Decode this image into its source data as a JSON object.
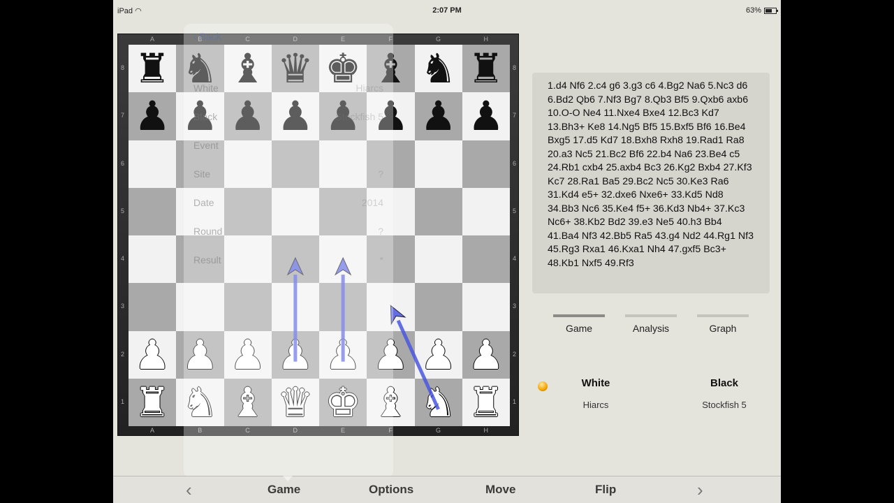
{
  "status_bar": {
    "device": "iPad",
    "wifi_icon": "wifi-icon",
    "time": "2:07 PM",
    "battery": "63%",
    "battery_fraction": 0.63
  },
  "board": {
    "files": [
      "A",
      "B",
      "C",
      "D",
      "E",
      "F",
      "G",
      "H"
    ],
    "ranks": [
      "8",
      "7",
      "6",
      "5",
      "4",
      "3",
      "2",
      "1"
    ],
    "position": [
      [
        "r",
        "n",
        "b",
        "q",
        "k",
        "b",
        "n",
        "r"
      ],
      [
        "p",
        "p",
        "p",
        "p",
        "p",
        "p",
        "p",
        "p"
      ],
      [
        "",
        "",
        "",
        "",
        "",
        "",
        "",
        ""
      ],
      [
        "",
        "",
        "",
        "",
        "",
        "",
        "",
        ""
      ],
      [
        "",
        "",
        "",
        "",
        "",
        "",
        "",
        ""
      ],
      [
        "",
        "",
        "",
        "",
        "",
        "",
        "",
        ""
      ],
      [
        "P",
        "P",
        "P",
        "P",
        "P",
        "P",
        "P",
        "P"
      ],
      [
        "R",
        "N",
        "B",
        "Q",
        "K",
        "B",
        "N",
        "R"
      ]
    ],
    "arrows": [
      {
        "from": "d2",
        "to": "d4"
      },
      {
        "from": "e2",
        "to": "e4"
      },
      {
        "from": "g1",
        "to": "f3"
      }
    ],
    "arrow_color": "#4a57e0"
  },
  "game_info_popup": {
    "back_label": "Back",
    "right_header": "",
    "rows": [
      {
        "label": "White",
        "value": "Hiarcs"
      },
      {
        "label": "Black",
        "value": "Stockfish 5"
      },
      {
        "label": "Event",
        "value": ""
      },
      {
        "label": "Site",
        "value": "?"
      },
      {
        "label": "Date",
        "value": "2014"
      },
      {
        "label": "Round",
        "value": "?"
      },
      {
        "label": "Result",
        "value": "*"
      }
    ]
  },
  "moves": {
    "text": "1.d4 Nf6 2.c4 g6 3.g3 c6 4.Bg2 Na6 5.Nc3 d6 6.Bd2 Qb6 7.Nf3 Bg7 8.Qb3 Bf5 9.Qxb6 axb6 10.O-O Ne4 11.Nxe4 Bxe4 12.Bc3 Kd7 13.Bh3+ Ke8 14.Ng5 Bf5 15.Bxf5 Bf6 16.Be4 Bxg5 17.d5 Kd7 18.Bxh8 Rxh8 19.Rad1 Ra8 20.a3 Nc5 21.Bc2 Bf6 22.b4 Na6 23.Be4 c5 24.Rb1 cxb4 25.axb4 Bc3 26.Kg2 Bxb4 27.Kf3 Kc7 28.Ra1 Ba5 29.Bc2 Nc5 30.Ke3 Ra6 31.Kd4 e5+ 32.dxe6 Nxe6+ 33.Kd5 Nd8 34.Bb3 Nc6 35.Ke4 f5+ 36.Kd3 Nb4+ 37.Kc3 Nc6+ 38.Kb2 Bd2 39.e3 Ne5 40.h3 Bb4 41.Ba4 Nf3 42.Bb5 Ra5 43.g4 Nd2 44.Rg1 Nf3 45.Rg3 Rxa1 46.Kxa1 Nh4 47.gxf5 Bc3+ 48.Kb1 Nxf5 49.Rf3"
  },
  "tabs": [
    {
      "label": "Game",
      "active": true
    },
    {
      "label": "Analysis",
      "active": false
    },
    {
      "label": "Graph",
      "active": false
    }
  ],
  "players": {
    "white_label": "White",
    "white_engine": "Hiarcs",
    "black_label": "Black",
    "black_engine": "Stockfish 5",
    "to_move": "white"
  },
  "toolbar": {
    "prev_icon": "chevron-left-icon",
    "next_icon": "chevron-right-icon",
    "game": "Game",
    "options": "Options",
    "move": "Move",
    "flip": "Flip"
  }
}
